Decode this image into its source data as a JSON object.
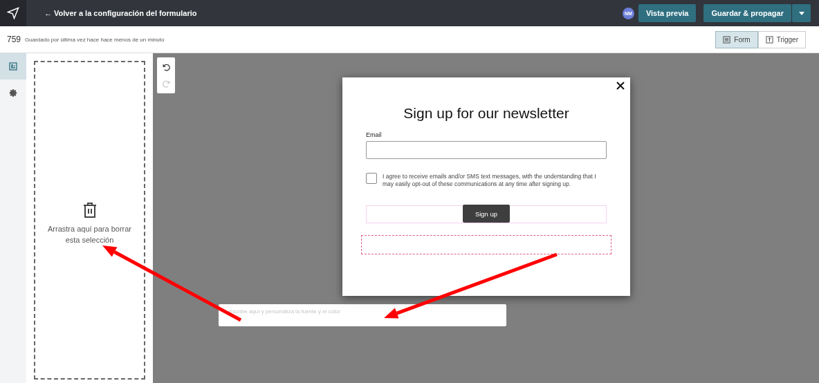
{
  "header": {
    "back_link": "← Volver a la configuración del formulario",
    "avatar": "NM",
    "preview_button": "Vista previa",
    "save_button": "Guardar & propagar"
  },
  "subheader": {
    "count": "759",
    "saved_text": "Guardado por última vez hace hace menos de un minuto",
    "view_tabs": [
      {
        "label": "Form",
        "kind": "form",
        "selected": true
      },
      {
        "label": "Trigger",
        "kind": "trigger",
        "selected": false
      }
    ]
  },
  "rail": [
    {
      "kind": "form",
      "selected": true
    },
    {
      "kind": "settings",
      "selected": false
    }
  ],
  "drop_zone": {
    "text": "Arrastra aquí para borrar esta selección"
  },
  "history": [
    {
      "kind": "undo",
      "disabled": false
    },
    {
      "kind": "redo",
      "disabled": true
    }
  ],
  "modal": {
    "title": "Sign up for our newsletter",
    "email_label": "Email",
    "consent": {
      "text": "I agree to receive emails and/or SMS text messages, with the understanding that I may easily opt-out of these communications at any time after signing up.",
      "checked": false
    },
    "submit": "Sign up"
  },
  "text_field": {
    "placeholder": "Escribe aquí y personaliza la fuente y el color"
  }
}
